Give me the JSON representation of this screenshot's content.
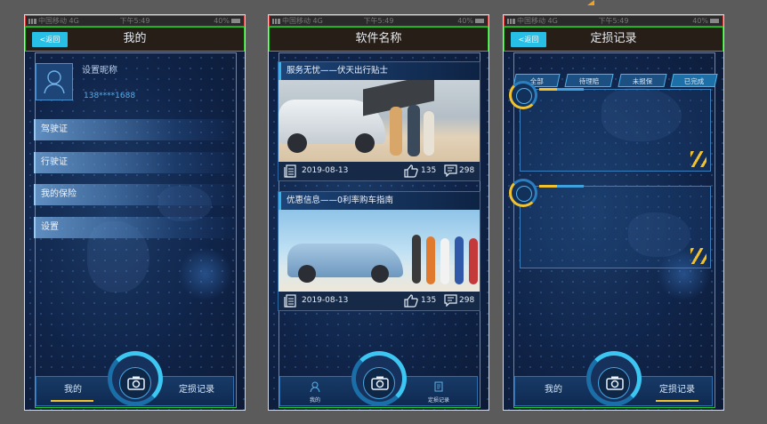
{
  "status_bar": {
    "carrier": "中国移动 4G",
    "time": "下午5:49",
    "battery": "40%"
  },
  "screen1": {
    "back_label": "<返回",
    "title": "我的",
    "nickname": "设置昵称",
    "phone": "138****1688",
    "menu": [
      "驾驶证",
      "行驶证",
      "我的保险",
      "设置"
    ],
    "nav_left": "我的",
    "nav_right": "定损记录"
  },
  "screen2": {
    "title": "软件名称",
    "cards": [
      {
        "title": "服务无忧——伏天出行贴士",
        "date": "2019-08-13",
        "likes": "135",
        "comments": "298"
      },
      {
        "title": "优惠信息——0利率购车指南",
        "date": "2019-08-13",
        "likes": "135",
        "comments": "298"
      }
    ],
    "nav_left": "我的",
    "nav_right": "定损记录"
  },
  "screen3": {
    "back_label": "<返回",
    "title": "定损记录",
    "filters": [
      "全部",
      "待理赔",
      "未报保",
      "已完成"
    ],
    "active_filter": "已完成",
    "nav_left": "我的",
    "nav_right": "定损记录"
  },
  "colors": {
    "accent": "#27bfe6",
    "highlight": "#f2c12e",
    "frame": "#28c428",
    "status_frame": "#e53b3b"
  }
}
